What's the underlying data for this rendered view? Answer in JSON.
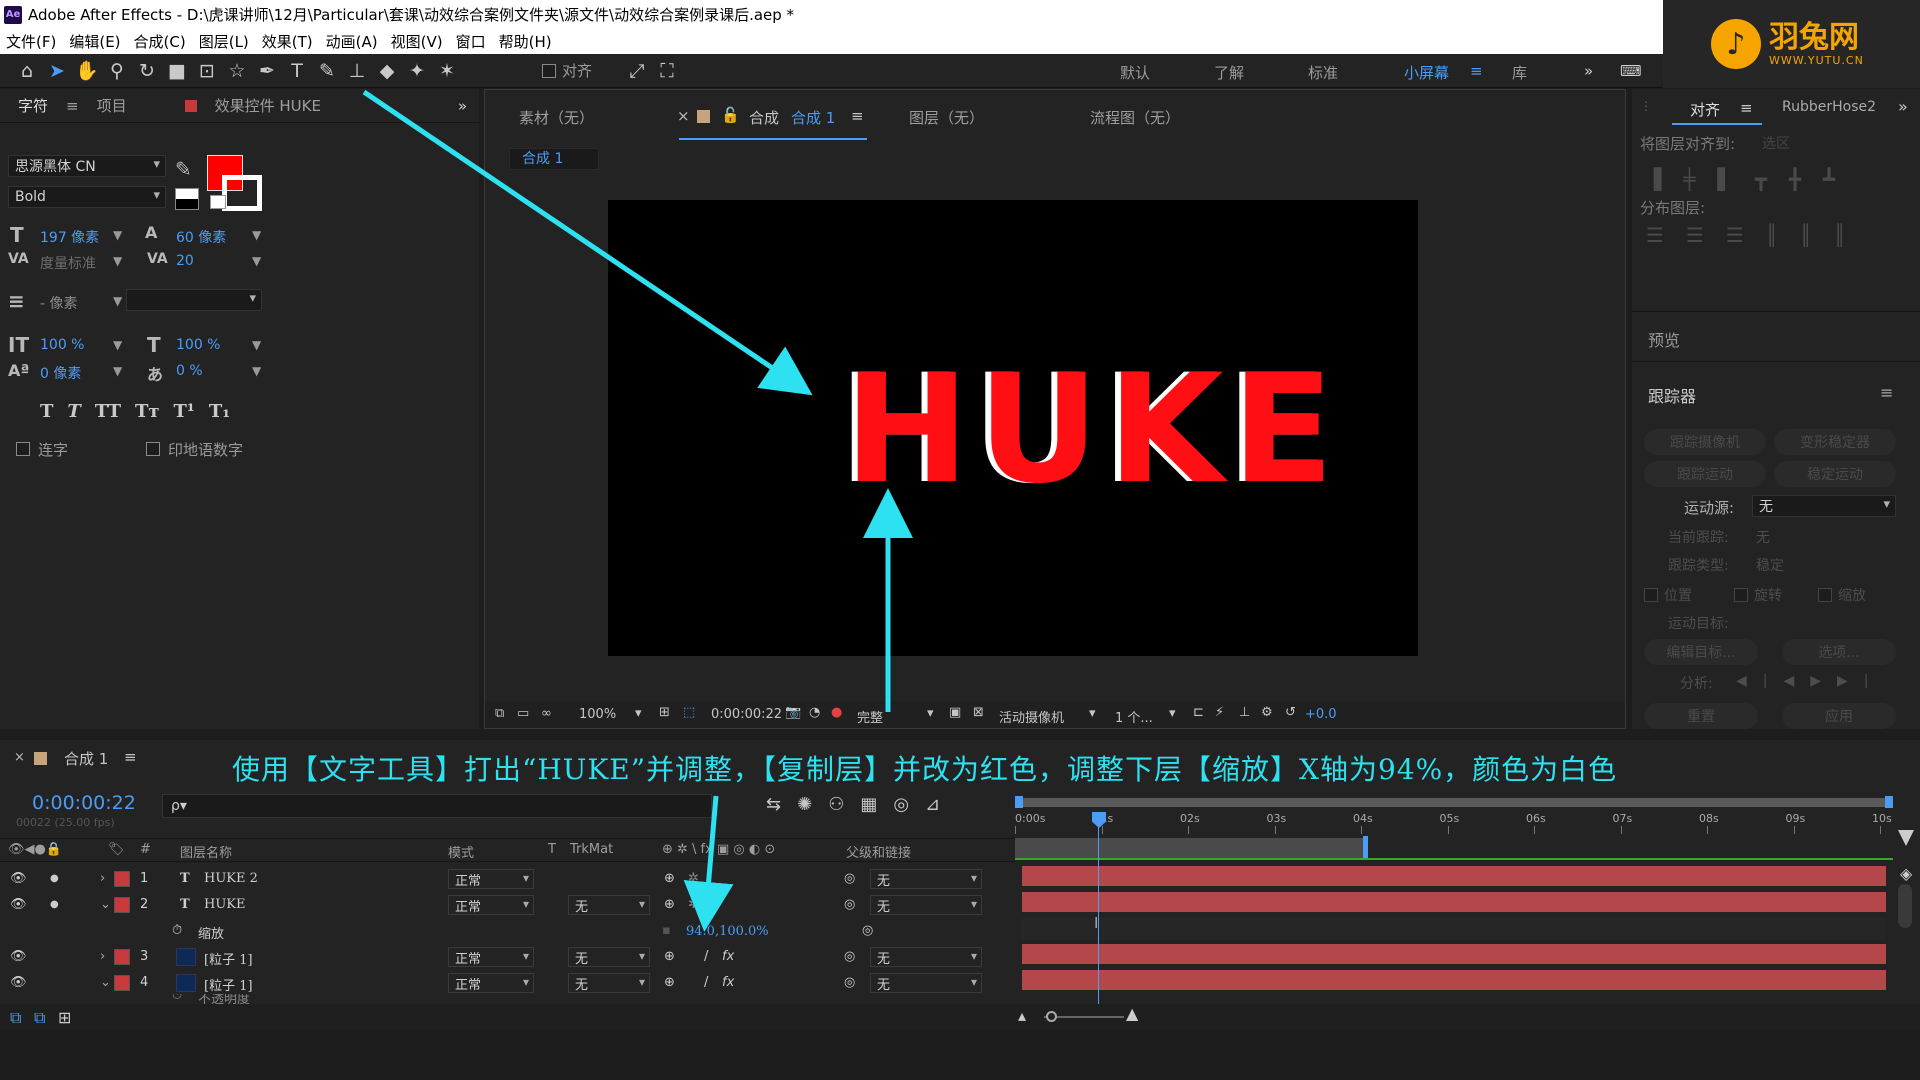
{
  "window": {
    "title": "Adobe After Effects - D:\\虎课讲师\\12月\\Particular\\套课\\动效综合案例文件夹\\源文件\\动效综合案例录课后.aep *",
    "app_badge": "Ae"
  },
  "menu": [
    "文件(F)",
    "编辑(E)",
    "合成(C)",
    "图层(L)",
    "效果(T)",
    "动画(A)",
    "视图(V)",
    "窗口",
    "帮助(H)"
  ],
  "brand": {
    "name": "羽兔网",
    "url": "WWW.YUTU.CN"
  },
  "toolbar": {
    "align_label": "对齐",
    "workspaces": [
      "默认",
      "了解",
      "标准",
      "小屏幕",
      "库"
    ],
    "active_workspace": "小屏幕"
  },
  "left_panel": {
    "tabs": [
      "字符",
      "项目",
      "效果控件 HUKE"
    ],
    "font_family": "思源黑体 CN",
    "font_style": "Bold",
    "font_size": "197 像素",
    "leading": "60 像素",
    "kerning": "度量标准",
    "tracking": "20",
    "stroke_width": "- 像素",
    "vertical_scale": "100 %",
    "horizontal_scale": "100 %",
    "baseline_shift": "0 像素",
    "tsume": "0 %",
    "style_buttons": [
      "T",
      "T",
      "TT",
      "Tт",
      "T¹",
      "T₁"
    ],
    "ligatures_label": "连字",
    "hindi_digits_label": "印地语数字",
    "fill_color": "#ff0000"
  },
  "viewer": {
    "tabs": [
      "素材（无）",
      "合成 合成 1",
      "图层（无）",
      "流程图（无）"
    ],
    "comp_prefix": "合成",
    "comp_name": "合成 1",
    "breadcrumb": "合成 1",
    "canvas_text": "HUKE",
    "zoom": "100%",
    "timecode": "0:00:00:22",
    "resolution": "完整",
    "camera": "活动摄像机",
    "views": "1 个...",
    "exposure": "+0.0"
  },
  "right_panel": {
    "tabs": [
      "对齐",
      "RubberHose2"
    ],
    "align_to_label": "将图层对齐到:",
    "align_to_value": "选区",
    "distribute_label": "分布图层:",
    "preview_label": "预览",
    "tracker_label": "跟踪器",
    "tracker_buttons": [
      "跟踪摄像机",
      "变形稳定器",
      "跟踪运动",
      "稳定运动"
    ],
    "motion_source_label": "运动源:",
    "motion_source_value": "无",
    "current_track_label": "当前跟踪:",
    "current_track_value": "无",
    "track_type_label": "跟踪类型:",
    "track_type_value": "稳定",
    "options": [
      "位置",
      "旋转",
      "缩放"
    ],
    "motion_target_label": "运动目标:",
    "edit_target": "编辑目标...",
    "options_btn": "选项...",
    "analyze_label": "分析:",
    "reset": "重置",
    "apply": "应用"
  },
  "caption": "使用【文字工具】打出“HUKE”并调整，【复制层】并改为红色，调整下层【缩放】X轴为94%，颜色为白色",
  "timeline": {
    "comp_tab": "合成 1",
    "timecode": "0:00:00:22",
    "frame_info": "00022 (25.00 fps)",
    "search_placeholder": "ρ▾",
    "columns": {
      "name": "图层名称",
      "mode": "模式",
      "t": "T",
      "trkmat": "TrkMat",
      "parent": "父级和链接",
      "num": "#"
    },
    "ruler": [
      "0:00s",
      "01s",
      "02s",
      "03s",
      "04s",
      "05s",
      "06s",
      "07s",
      "08s",
      "09s",
      "10s"
    ],
    "layers": [
      {
        "num": "1",
        "type": "T",
        "name": "HUKE 2",
        "mode": "正常",
        "trkmat": "",
        "parent": "无"
      },
      {
        "num": "2",
        "type": "T",
        "name": "HUKE",
        "mode": "正常",
        "trkmat": "无",
        "parent": "无"
      },
      {
        "num": "3",
        "type": "",
        "name": "[粒子 1]",
        "mode": "正常",
        "trkmat": "无",
        "parent": "无"
      },
      {
        "num": "4",
        "type": "",
        "name": "[粒子 1]",
        "mode": "正常",
        "trkmat": "无",
        "parent": "无"
      }
    ],
    "scale_prop_label": "缩放",
    "scale_prop_value": "94.0,100.0%",
    "opacity_prop_label": "不透明度"
  }
}
